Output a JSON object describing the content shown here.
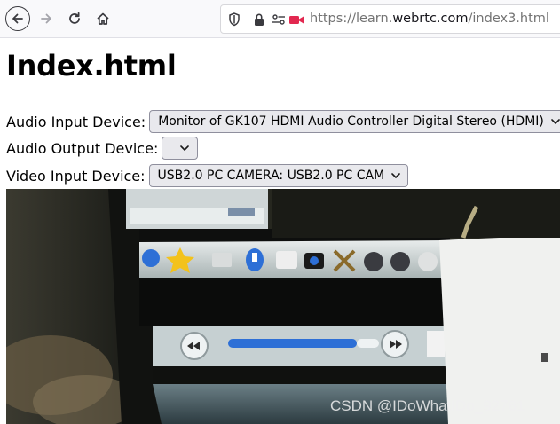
{
  "browser": {
    "url_prefix": "https://learn.",
    "url_domain": "webrtc.com",
    "url_path": "/index3.html"
  },
  "page": {
    "title": "Index.html",
    "audio_input_label": "Audio Input Device:",
    "audio_input_value": "Monitor of GK107 HDMI Audio Controller Digital Stereo (HDMI)",
    "audio_output_label": "Audio Output Device:",
    "audio_output_value": "",
    "video_input_label": "Video Input Device:",
    "video_input_value": "USB2.0 PC CAMERA: USB2.0 PC CAM"
  },
  "video": {
    "watermark": "CSDN @IDoWhatIDo_92761"
  },
  "colors": {
    "camera_indicator": "#e22850",
    "taskbar_blue": "#2d6fd6"
  }
}
